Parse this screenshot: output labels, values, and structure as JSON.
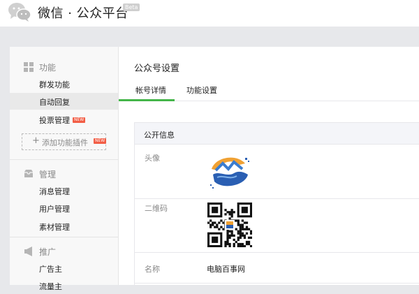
{
  "header": {
    "brand": "微信 · 公众平台",
    "beta": "Beta"
  },
  "sidebar": {
    "groups": [
      {
        "title": "功能",
        "icon": "grid-icon",
        "items": [
          {
            "label": "群发功能",
            "active": false
          },
          {
            "label": "自动回复",
            "active": true
          },
          {
            "label": "投票管理",
            "active": false,
            "badge": "NEW"
          }
        ],
        "add_plugin": {
          "label": "添加功能插件",
          "badge": "NEW"
        }
      },
      {
        "title": "管理",
        "icon": "inbox-icon",
        "items": [
          {
            "label": "消息管理"
          },
          {
            "label": "用户管理"
          },
          {
            "label": "素材管理"
          }
        ]
      },
      {
        "title": "推广",
        "icon": "megaphone-icon",
        "items": [
          {
            "label": "广告主"
          },
          {
            "label": "流量主"
          }
        ]
      }
    ]
  },
  "main": {
    "title": "公众号设置",
    "tabs": [
      {
        "label": "帐号详情",
        "active": true
      },
      {
        "label": "功能设置",
        "active": false
      }
    ],
    "panel": {
      "heading": "公开信息",
      "fields": [
        {
          "label": "头像"
        },
        {
          "label": "二维码"
        },
        {
          "label": "名称",
          "value": "电脑百事网"
        }
      ]
    }
  },
  "colors": {
    "accent": "#44b549",
    "badge": "#f25d45",
    "page_bg": "#e7e8eb"
  }
}
